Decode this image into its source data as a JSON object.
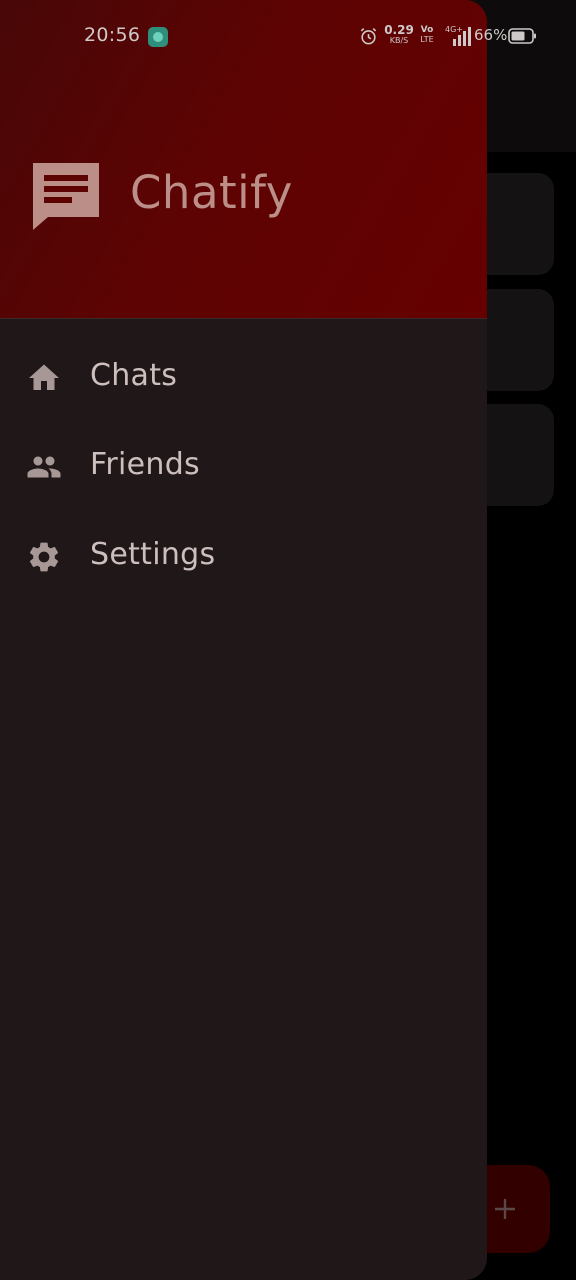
{
  "status_bar": {
    "time": "20:56",
    "net_speed_value": "0.29",
    "net_speed_unit": "KB/S",
    "volte_top": "Vo",
    "volte_bottom": "LTE",
    "network_type": "4G+",
    "battery_percent": "66%",
    "icons": [
      "app-notification-icon",
      "alarm-icon",
      "signal-icon",
      "battery-icon"
    ]
  },
  "drawer": {
    "app_title": "Chatify",
    "logo_icon": "chat-bubble-icon",
    "nav_items": [
      {
        "label": "Chats",
        "icon": "home-icon"
      },
      {
        "label": "Friends",
        "icon": "people-icon"
      },
      {
        "label": "Settings",
        "icon": "gear-icon"
      }
    ]
  },
  "background": {
    "fab_icon": "plus-icon"
  },
  "colors": {
    "header_gradient_start": "#480707",
    "header_gradient_end": "#660000",
    "drawer_background": "#201818",
    "title_color": "#bb8e88",
    "nav_text": "#cdbfbd",
    "nav_icon": "#a89895"
  }
}
